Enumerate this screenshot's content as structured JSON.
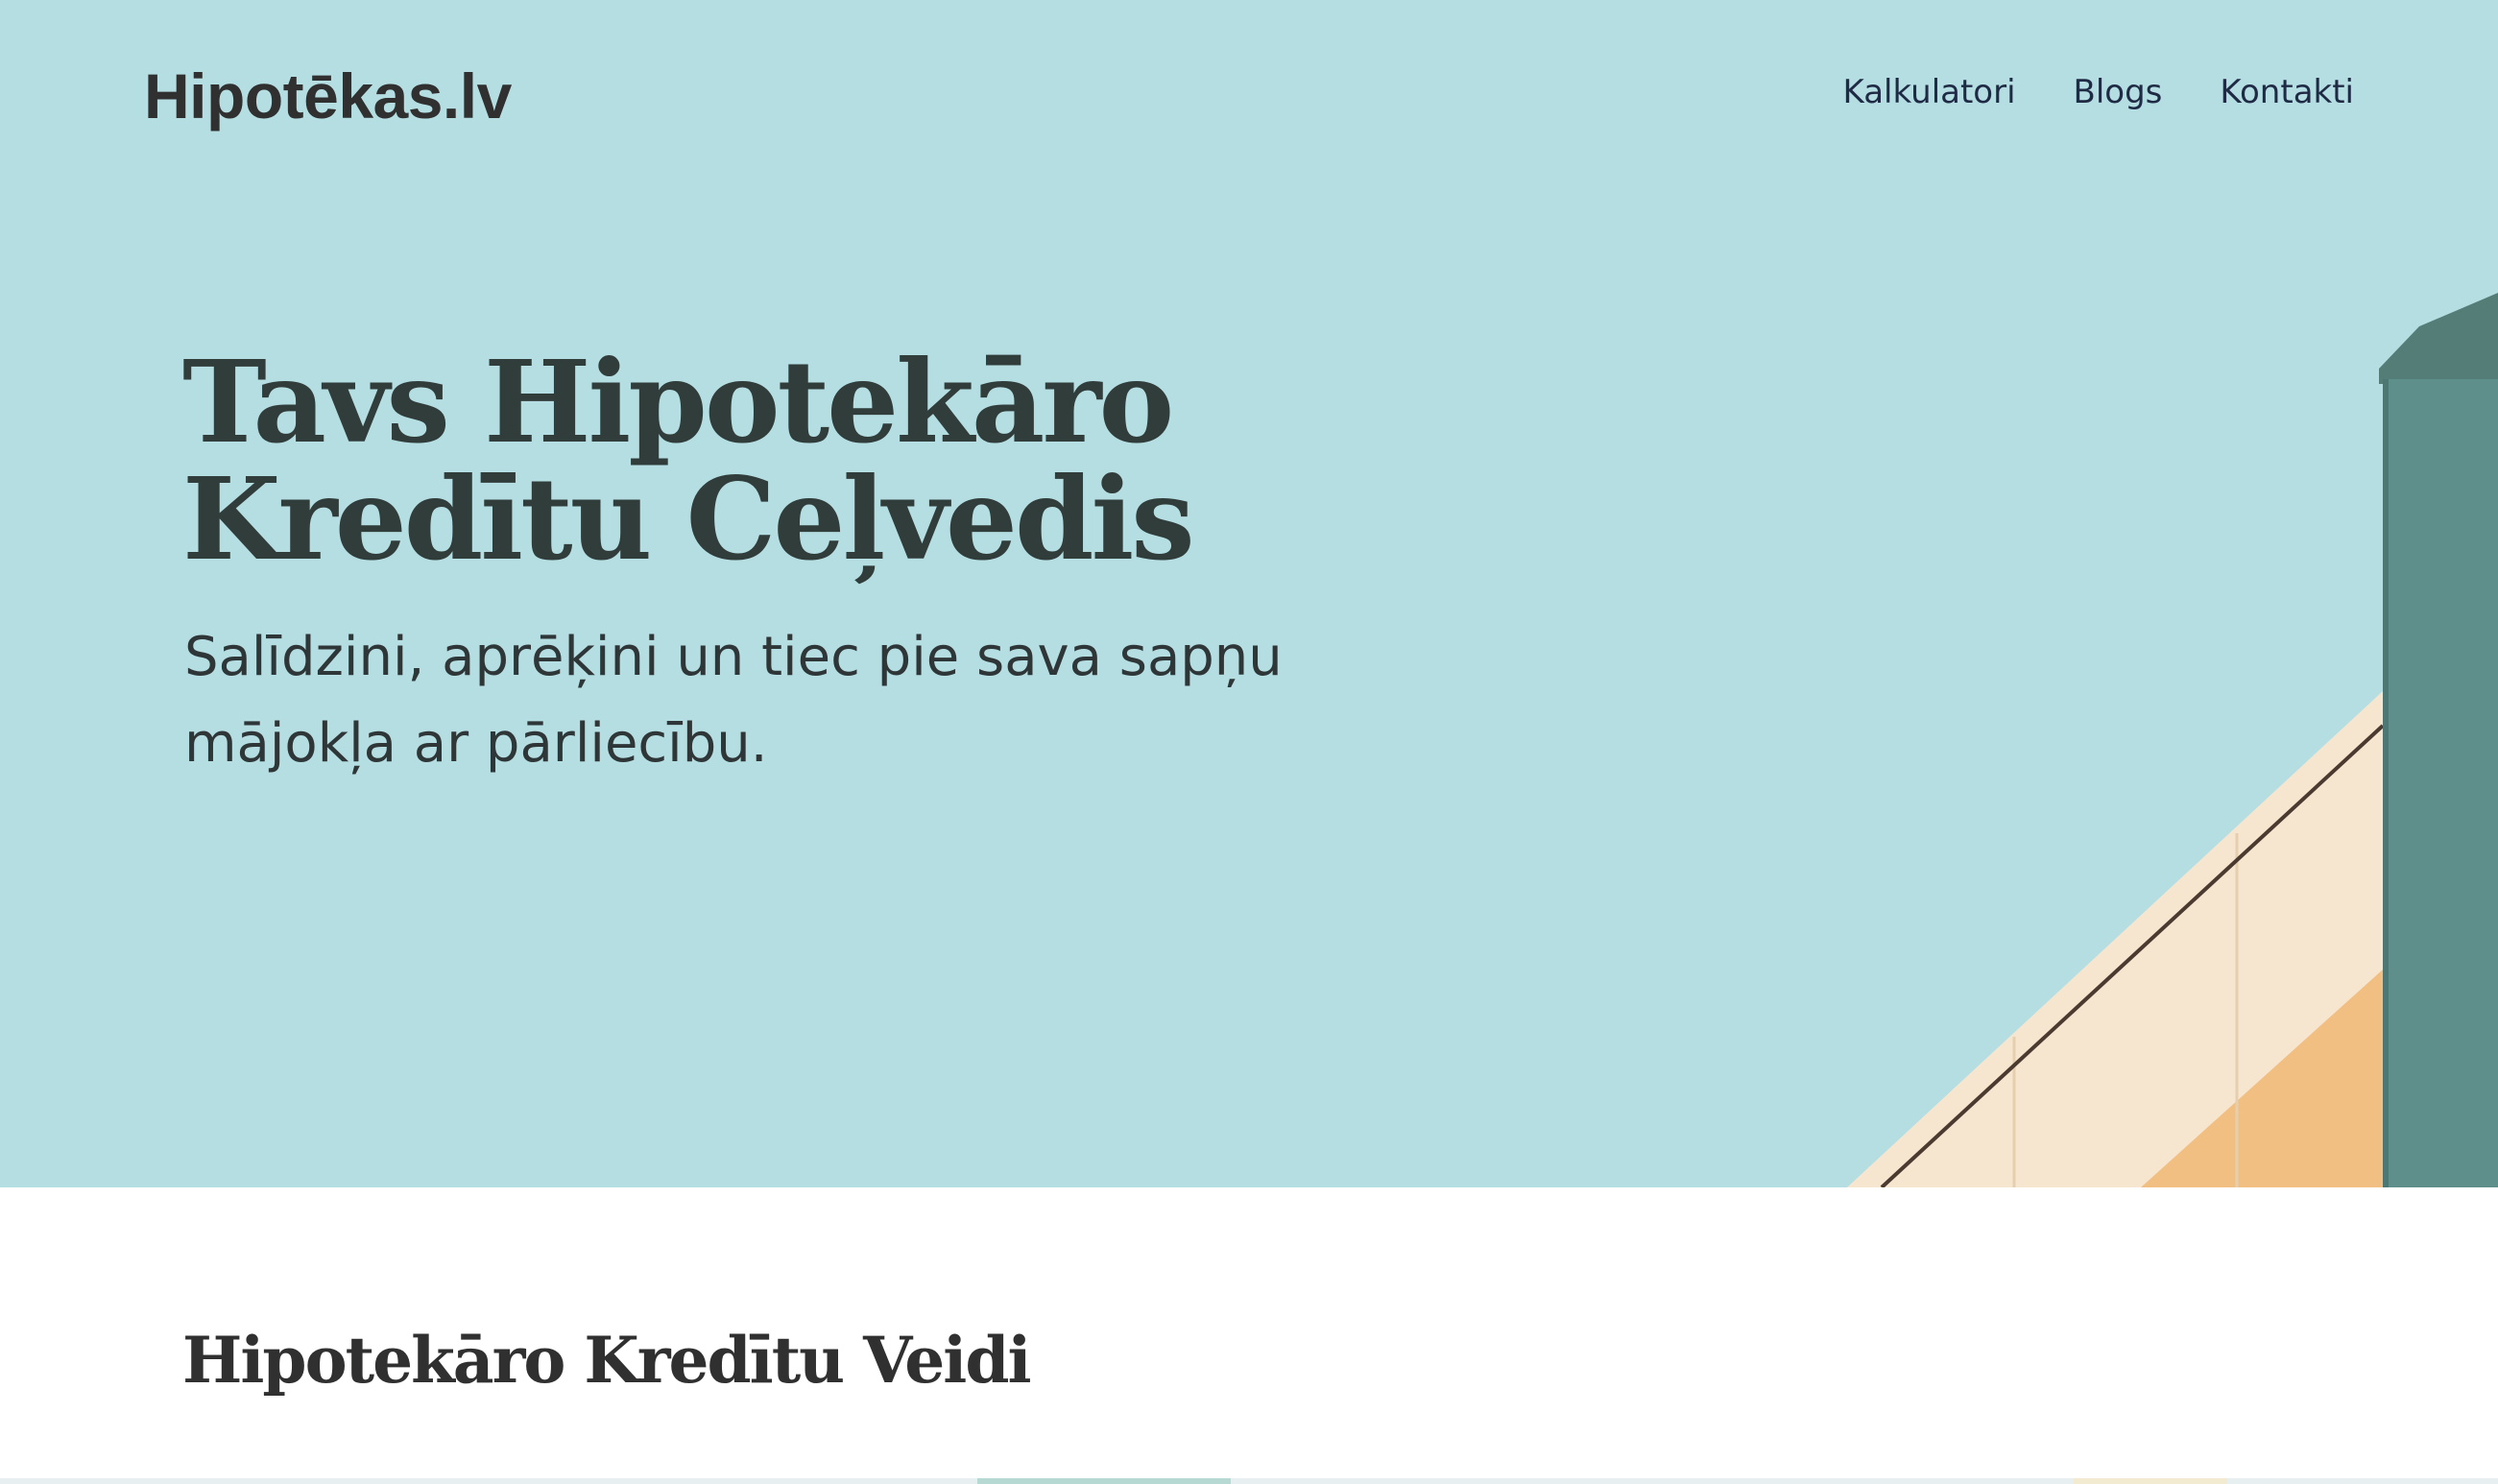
{
  "header": {
    "logo": "Hipotēkas.lv",
    "nav": [
      "Kalkulatori",
      "Blogs",
      "Kontakti"
    ]
  },
  "hero": {
    "title_line1": "Tavs Hipotekāro",
    "title_line2": "Kredītu Ceļvedis",
    "subtitle_line1": "Salīdzini, aprēķini un tiec pie sava sapņu",
    "subtitle_line2": "mājokļa ar pārliecību."
  },
  "section": {
    "title": "Hipotekāro Kredītu Veidi"
  },
  "colors": {
    "hero_sky": "#b5dee3",
    "text_dark": "#313d3a",
    "nav_text": "#1f2a44",
    "tower": "#5f8f8a",
    "facade_light": "#f7e6cf",
    "facade_orange": "#f2bf83"
  }
}
